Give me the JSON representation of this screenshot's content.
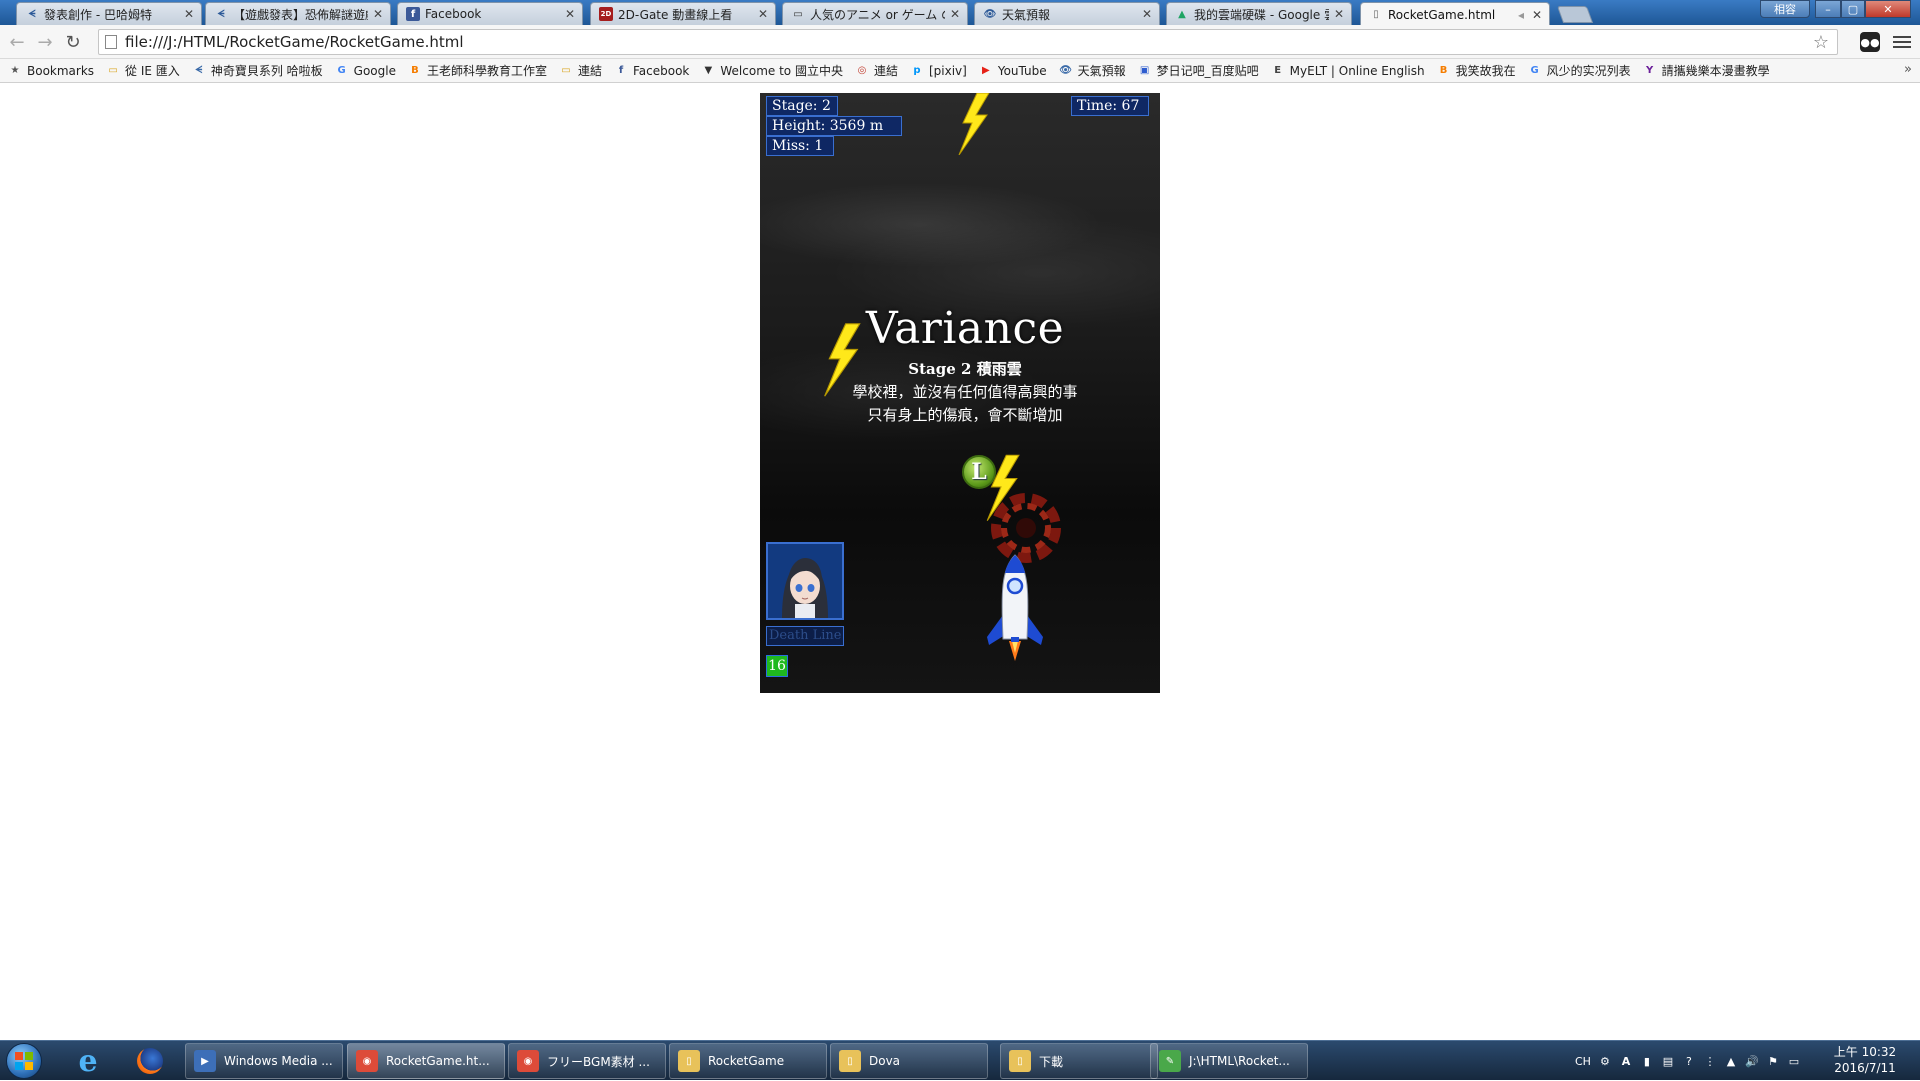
{
  "tabs": [
    {
      "label": "發表創作 - 巴哈姆特",
      "fav": "ᗕ"
    },
    {
      "label": "【遊戲發表】恐佈解謎遊戲",
      "fav": "ᗕ"
    },
    {
      "label": "Facebook",
      "fav": "f"
    },
    {
      "label": "2D-Gate 動畫線上看",
      "fav": "2D"
    },
    {
      "label": "人気のアニメ or ゲーム の",
      "fav": "▭"
    },
    {
      "label": "天氣預報",
      "fav": "👁"
    },
    {
      "label": "我的雲端硬碟 - Google 雲",
      "fav": "▲"
    },
    {
      "label": "RocketGame.html",
      "fav": "▯"
    }
  ],
  "window": {
    "user": "相容",
    "minimize": "–",
    "maximize": "▢",
    "close": "✕"
  },
  "toolbar": {
    "back": "←",
    "forward": "→",
    "reload": "↻",
    "url": "file:///J:/HTML/RocketGame/RocketGame.html",
    "star": "☆"
  },
  "bookmarks": [
    {
      "label": "Bookmarks",
      "icon": "★",
      "color": "#555555"
    },
    {
      "label": "從 IE 匯入",
      "icon": "▭",
      "color": "#d9a520"
    },
    {
      "label": "神奇寶貝系列 哈啦板",
      "icon": "ᗕ",
      "color": "#3a6aa8"
    },
    {
      "label": "Google",
      "icon": "G",
      "color": "#4285f4"
    },
    {
      "label": "王老師科學教育工作室",
      "icon": "B",
      "color": "#f57d00"
    },
    {
      "label": "連結",
      "icon": "▭",
      "color": "#d9a520"
    },
    {
      "label": "Facebook",
      "icon": "f",
      "color": "#3b5998"
    },
    {
      "label": "Welcome to 國立中央",
      "icon": "▼",
      "color": "#333333"
    },
    {
      "label": "連結",
      "icon": "◎",
      "color": "#c0392b"
    },
    {
      "label": "[pixiv]",
      "icon": "p",
      "color": "#0096fa"
    },
    {
      "label": "YouTube",
      "icon": "▶",
      "color": "#e62117"
    },
    {
      "label": "天氣預報",
      "icon": "👁",
      "color": "#3a6aa8"
    },
    {
      "label": "梦日记吧_百度贴吧",
      "icon": "▣",
      "color": "#2d5ccf"
    },
    {
      "label": "MyELT | Online English",
      "icon": "E",
      "color": "#444444"
    },
    {
      "label": "我笑故我在",
      "icon": "B",
      "color": "#f57d00"
    },
    {
      "label": "风少的实况列表",
      "icon": "G",
      "color": "#4285f4"
    },
    {
      "label": "請攜幾樂本漫畫教學",
      "icon": "Y",
      "color": "#6b1f9a"
    }
  ],
  "bookmarks_more": "»",
  "hud": {
    "stage": "Stage: 2",
    "height": "Height: 3569 m",
    "miss": "Miss: 1",
    "time": "Time: 67"
  },
  "title": {
    "main": "Variance",
    "sub": "Stage 2 積雨雲",
    "line1": "學校裡，並沒有任何值得高興的事",
    "line2": "只有身上的傷痕，會不斷增加"
  },
  "life_token": "L",
  "death_line": "Death Line",
  "counter": "16",
  "taskbar": [
    {
      "label": "Windows Media ...",
      "icon": "▶",
      "color": "#3d6fb8"
    },
    {
      "label": "RocketGame.ht...",
      "icon": "◉",
      "color": "#dd4b39",
      "active": true
    },
    {
      "label": "フリーBGM素材 ...",
      "icon": "◉",
      "color": "#dd4b39"
    },
    {
      "label": "RocketGame",
      "icon": "▯",
      "color": "#e8c25a"
    },
    {
      "label": "Dova",
      "icon": "▯",
      "color": "#e8c25a"
    },
    {
      "label": "下載",
      "icon": "▯",
      "color": "#e8c25a"
    },
    {
      "label": "J:\\HTML\\Rocket...",
      "icon": "✎",
      "color": "#4aa84a"
    }
  ],
  "tray": {
    "lang": "CH",
    "time": "上午 10:32",
    "date": "2016/7/11"
  },
  "colors": {
    "hud_bg": "#0a286e",
    "hud_border": "#3a6fd0",
    "counter_bg": "#1fb81f",
    "bolt": "#ffe81a"
  }
}
